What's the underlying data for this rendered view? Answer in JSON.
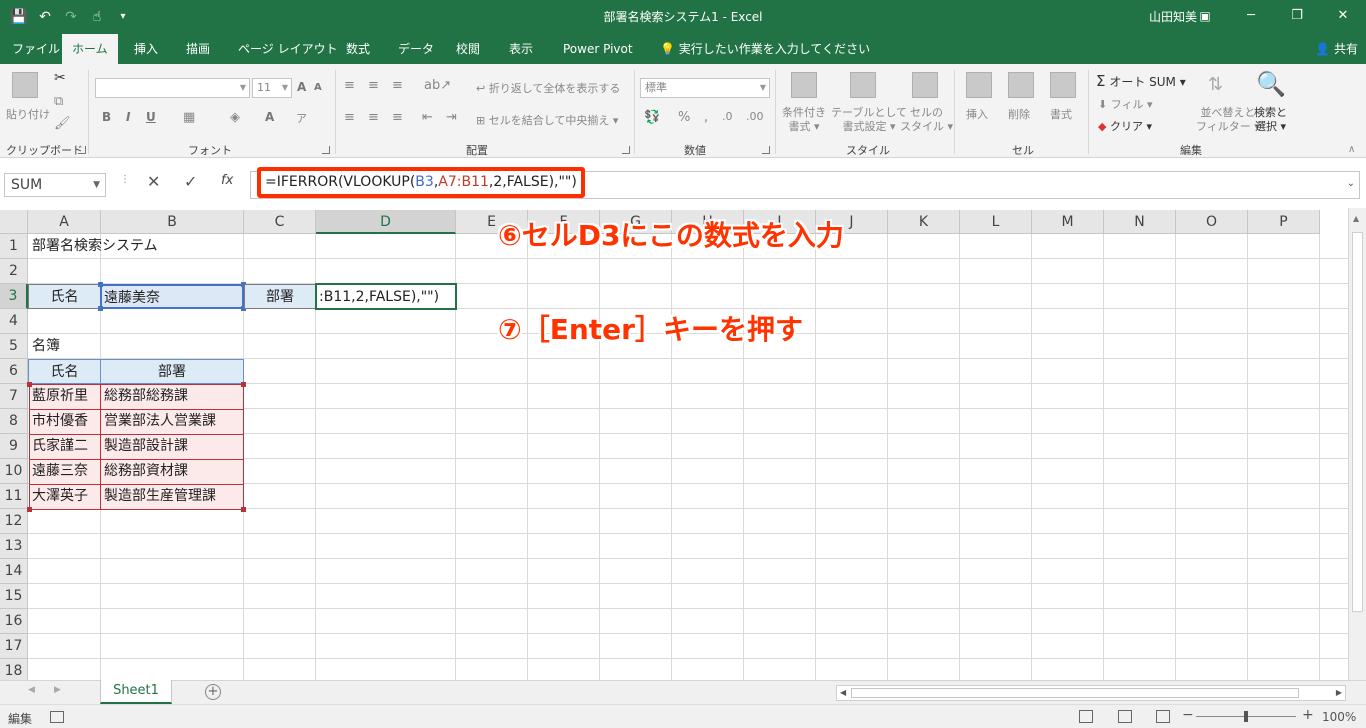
{
  "window": {
    "title": "部署名検索システム1 - Excel",
    "user": "山田知美",
    "ribbon_options_icon": "ribbon-display-options-icon"
  },
  "qat": {
    "save_icon": "save-icon",
    "undo_icon": "undo-icon",
    "redo_icon": "redo-icon",
    "touch_icon": "touch-mode-icon"
  },
  "tabs": [
    {
      "label": "ファイル"
    },
    {
      "label": "ホーム"
    },
    {
      "label": "挿入"
    },
    {
      "label": "描画"
    },
    {
      "label": "ページ レイアウト"
    },
    {
      "label": "数式"
    },
    {
      "label": "データ"
    },
    {
      "label": "校閲"
    },
    {
      "label": "表示"
    },
    {
      "label": "Power Pivot"
    },
    {
      "label": "実行したい作業を入力してください"
    }
  ],
  "share_label": "共有",
  "ribbon": {
    "clipboard": {
      "label": "クリップボード",
      "paste": "貼り付け"
    },
    "font": {
      "label": "フォント",
      "size": "11"
    },
    "alignment": {
      "label": "配置",
      "wrap": "折り返して全体を表示する",
      "merge": "セルを結合して中央揃え"
    },
    "number": {
      "label": "数値",
      "format": "標準"
    },
    "styles": {
      "label": "スタイル",
      "cond1": "条件付き",
      "cond2": "書式",
      "table1": "テーブルとして",
      "table2": "書式設定",
      "cell1": "セルの",
      "cell2": "スタイル"
    },
    "cells": {
      "label": "セル",
      "insert": "挿入",
      "delete": "削除",
      "format": "書式"
    },
    "editing": {
      "label": "編集",
      "autosum": "オート SUM",
      "fill": "フィル",
      "clear": "クリア",
      "sort1": "並べ替えと",
      "sort2": "フィルター",
      "find1": "検索と",
      "find2": "選択"
    }
  },
  "formula_bar": {
    "name_box": "SUM",
    "fx": "fx",
    "formula_parts": [
      "=IFERROR(VLOOKUP(",
      "B3",
      ",",
      "A7:B11",
      ",2,FALSE),\"\")"
    ]
  },
  "grid": {
    "columns": [
      "A",
      "B",
      "C",
      "D",
      "E",
      "F",
      "G",
      "H",
      "I",
      "J",
      "K",
      "L",
      "M",
      "N",
      "O",
      "P"
    ],
    "rows": [
      "1",
      "2",
      "3",
      "4",
      "5",
      "6",
      "7",
      "8",
      "9",
      "10",
      "11",
      "12",
      "13",
      "14",
      "15",
      "16",
      "17",
      "18"
    ],
    "a1": "部署名検索システム",
    "a3": "氏名",
    "b3": "遠藤美奈",
    "c3": "部署",
    "d3": ":B11,2,FALSE),\"\")",
    "a5": "名簿",
    "header_name": "氏名",
    "header_dept": "部署",
    "directory": [
      {
        "name": "藍原祈里",
        "dept": "総務部総務課"
      },
      {
        "name": "市村優香",
        "dept": "営業部法人営業課"
      },
      {
        "name": "氏家謹二",
        "dept": "製造部設計課"
      },
      {
        "name": "遠藤三奈",
        "dept": "総務部資材課"
      },
      {
        "name": "大澤英子",
        "dept": "製造部生産管理課"
      }
    ]
  },
  "annotations": {
    "step6": "⑥セルD3にこの数式を入力",
    "step7": "⑦［Enter］キーを押す"
  },
  "sheets": {
    "active": "Sheet1"
  },
  "status": {
    "mode": "編集",
    "zoom": "100%"
  },
  "colors": {
    "excel_green": "#217346",
    "annotation_red": "#ff3300",
    "header_fill": "#ddebf7",
    "table_fill": "#fce9ea"
  }
}
